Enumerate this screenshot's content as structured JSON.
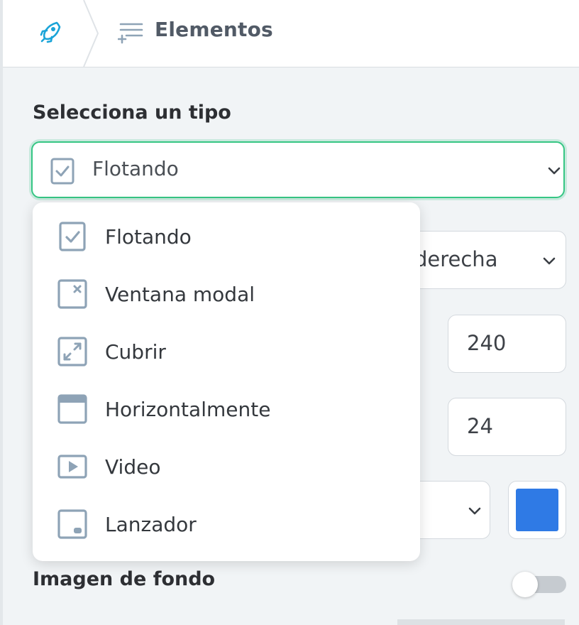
{
  "header": {
    "title": "Elementos",
    "logo_icon": "rocket-logo-icon",
    "section_icon": "elements-list-icon"
  },
  "type_section": {
    "label": "Selecciona un tipo",
    "selected": "Flotando",
    "selected_icon": "checkbox-icon"
  },
  "menu": {
    "items": [
      {
        "label": "Flotando",
        "icon": "checkbox-icon"
      },
      {
        "label": "Ventana modal",
        "icon": "modal-close-icon"
      },
      {
        "label": "Cubrir",
        "icon": "expand-icon"
      },
      {
        "label": "Horizontalmente",
        "icon": "horizontal-bar-icon"
      },
      {
        "label": "Video",
        "icon": "video-play-icon"
      },
      {
        "label": "Lanzador",
        "icon": "launcher-icon"
      }
    ]
  },
  "background": {
    "position_value": "a derecha",
    "width_value": "240",
    "radius_value": "24",
    "color_swatch": "#2f7ae5",
    "image_label": "Imagen de fondo",
    "image_toggle": false
  },
  "colors": {
    "accent": "#36c684",
    "icon": "#8ea3b6",
    "logo": "#1aa4d8"
  }
}
